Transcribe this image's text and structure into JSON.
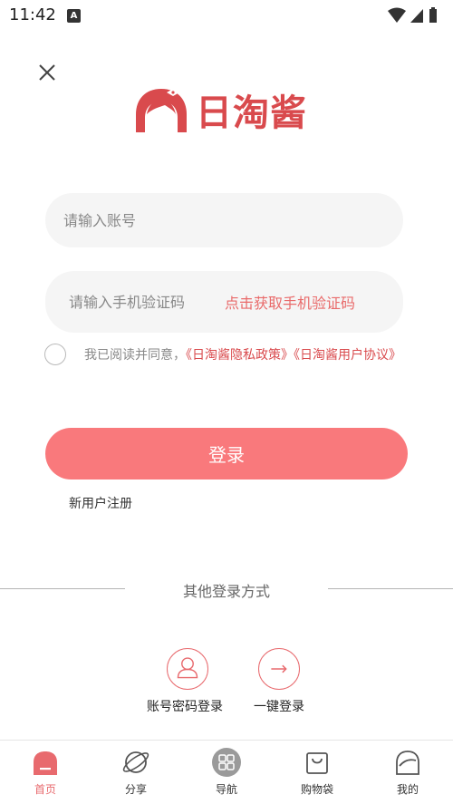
{
  "status_bar": {
    "time": "11:42",
    "notification_letter": "A"
  },
  "logo": {
    "text": "日淘酱"
  },
  "form": {
    "account_placeholder": "请输入账号",
    "code_placeholder": "请输入手机验证码",
    "get_code_label": "点击获取手机验证码"
  },
  "agreement": {
    "prefix": "我已阅读并同意，",
    "privacy_link": "《日淘酱隐私政策》",
    "user_link": "《日淘酱用户协议》"
  },
  "login_button": "登录",
  "register_link": "新用户注册",
  "other_login": {
    "title": "其他登录方式",
    "account_password_label": "账号密码登录",
    "one_key_label": "一键登录"
  },
  "tabs": [
    {
      "label": "首页",
      "icon": "home-icon",
      "active": true
    },
    {
      "label": "分享",
      "icon": "planet-icon",
      "active": false
    },
    {
      "label": "导航",
      "icon": "grid-icon",
      "active": false
    },
    {
      "label": "购物袋",
      "icon": "shopping-bag-icon",
      "active": false
    },
    {
      "label": "我的",
      "icon": "profile-icon",
      "active": false
    }
  ],
  "colors": {
    "accent": "#f9797c",
    "brand_red": "#d94a4d",
    "link_red": "#e96a6a",
    "input_bg": "#f5f5f5"
  }
}
